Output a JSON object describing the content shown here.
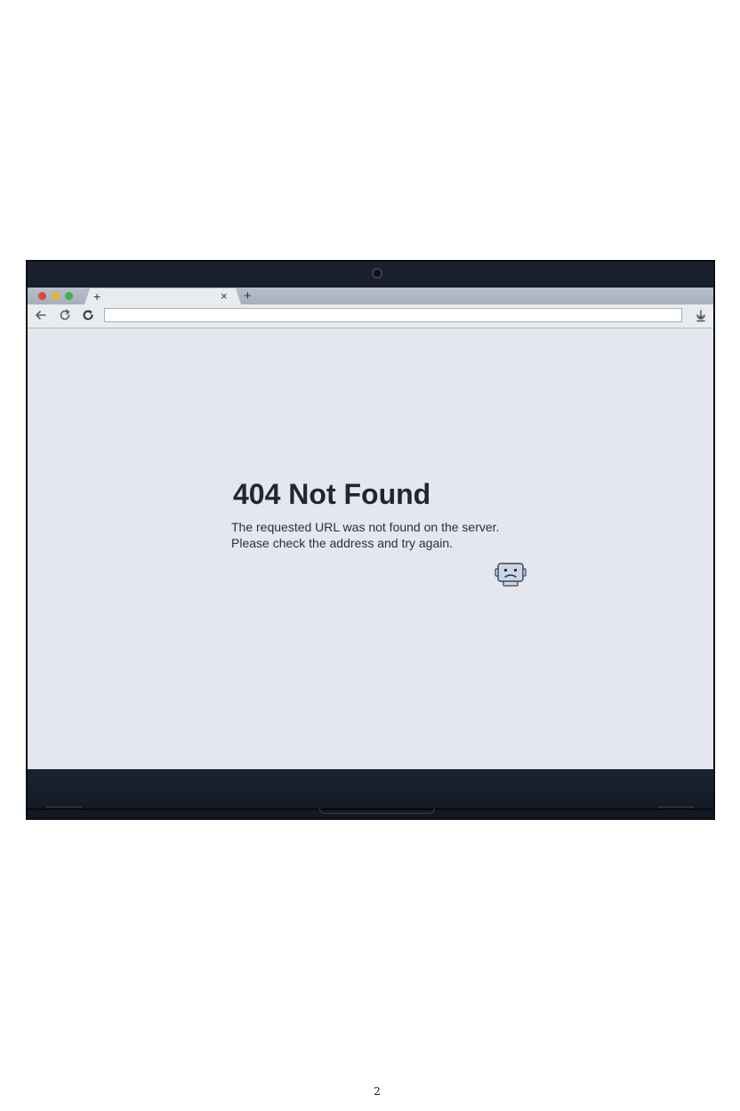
{
  "browser": {
    "tabs": [
      {
        "label": "+",
        "close_label": "×"
      }
    ],
    "new_tab_label": "+",
    "address_bar": {
      "value": "",
      "placeholder": ""
    },
    "colors": {
      "close": "#e0443b",
      "minimize": "#e9b227",
      "maximize": "#3fb54a"
    }
  },
  "page": {
    "title": "404 Not Found",
    "line1": "The requested URL was not found on the server.",
    "line2": "Please check the address and try again.",
    "illustration": "sad-robot-icon"
  },
  "footer": {
    "page_number": "2"
  }
}
